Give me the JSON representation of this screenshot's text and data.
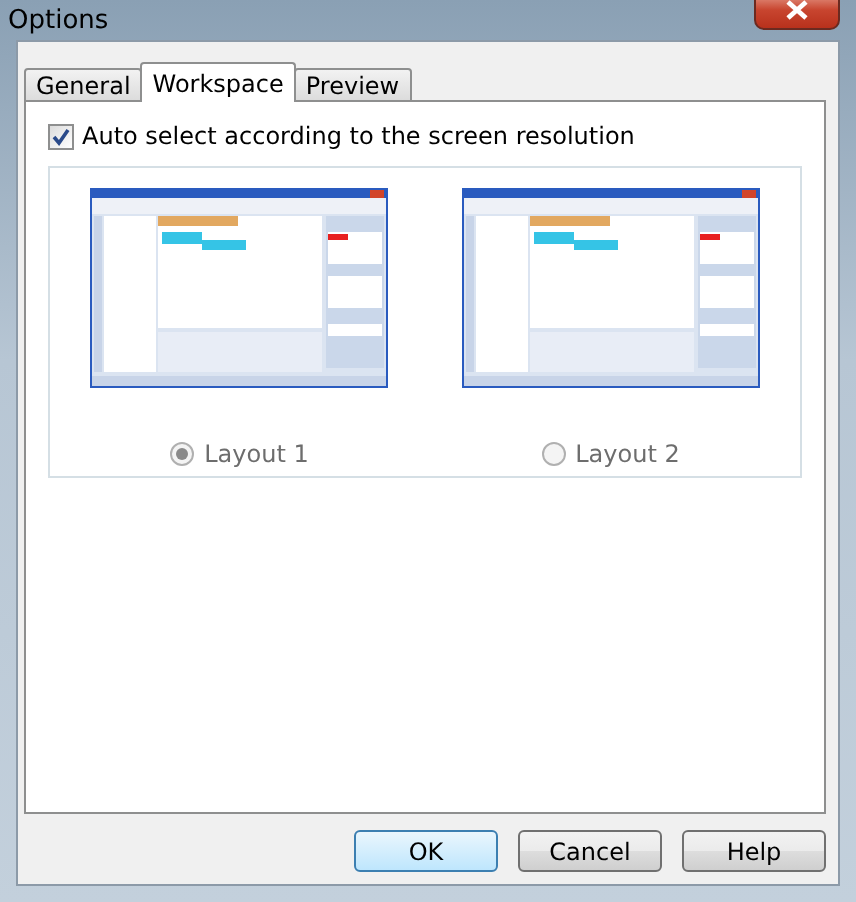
{
  "window": {
    "title": "Options"
  },
  "tabs": [
    {
      "label": "General",
      "selected": false
    },
    {
      "label": "Workspace",
      "selected": true
    },
    {
      "label": "Preview",
      "selected": false
    }
  ],
  "auto_select": {
    "label": "Auto select according to the screen resolution",
    "checked": true
  },
  "layouts": [
    {
      "label": "Layout 1",
      "selected": true,
      "disabled": true
    },
    {
      "label": "Layout 2",
      "selected": false,
      "disabled": true
    }
  ],
  "buttons": [
    {
      "label": "OK",
      "default": true
    },
    {
      "label": "Cancel",
      "default": false
    },
    {
      "label": "Help",
      "default": false
    }
  ]
}
